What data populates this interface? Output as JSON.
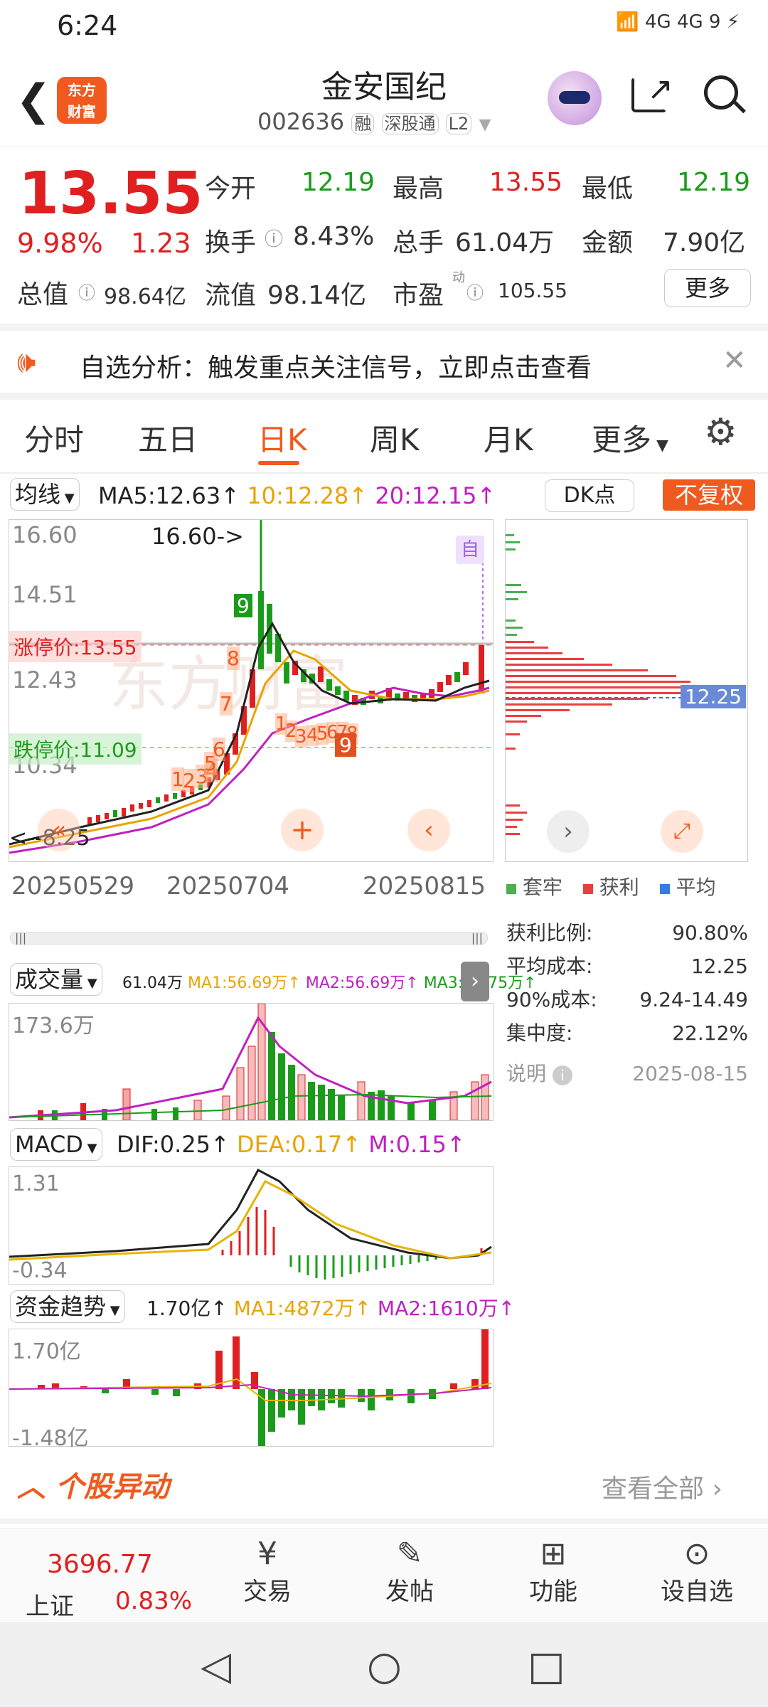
{
  "status_bar": {
    "time": "6:24",
    "indicators": "4G 4G 9"
  },
  "header": {
    "logo_text_1": "东方",
    "logo_text_2": "财富",
    "stock_name": "金安国纪",
    "stock_code": "002636",
    "tags": [
      "融",
      "深股通",
      "L2"
    ]
  },
  "quote": {
    "price": "13.55",
    "change_pct": "9.98%",
    "change": "1.23",
    "open_label": "今开",
    "open": "12.19",
    "high_label": "最高",
    "high": "13.55",
    "low_label": "最低",
    "low": "12.19",
    "turnover_label": "换手",
    "turnover": "8.43%",
    "volume_label": "总手",
    "volume": "61.04万",
    "amount_label": "金额",
    "amount": "7.90亿",
    "mktcap_label": "总值",
    "mktcap": "98.64亿",
    "float_label": "流值",
    "float_cap": "98.14亿",
    "pe_label": "市盈",
    "pe_sup": "动",
    "pe": "105.55",
    "more_button": "更多"
  },
  "alert": {
    "text": "自选分析：触发重点关注信号，立即点击查看"
  },
  "tabs": [
    "分时",
    "五日",
    "日K",
    "周K",
    "月K",
    "更多"
  ],
  "kchart": {
    "ma_selector": "均线",
    "ma5": "MA5:12.63↑",
    "ma10": "10:12.28↑",
    "ma20": "20:12.15↑",
    "dk_button": "DK点",
    "fq_button": "不复权",
    "y_top": "16.60",
    "y2": "14.51",
    "y3": "12.43",
    "y4": "10.34",
    "limit_up": "涨停价:13.55",
    "limit_down": "跌停价:11.09",
    "high_marker": "16.60->",
    "low_marker": "<--8.25",
    "auto_tag": "自",
    "dates": [
      "20250529",
      "20250704",
      "20250815"
    ],
    "watermark": "东方财富",
    "signals_up": [
      "1",
      "2",
      "3",
      "4",
      "5",
      "6",
      "7",
      "8",
      "9"
    ],
    "signals_down": [
      "1",
      "2",
      "3",
      "4",
      "5",
      "6",
      "7",
      "8",
      "9"
    ]
  },
  "chip": {
    "avg_tag": "12.25",
    "legend": [
      "套牢",
      "获利",
      "平均"
    ],
    "rows": [
      {
        "label": "获利比例:",
        "value": "90.80%"
      },
      {
        "label": "平均成本:",
        "value": "12.25"
      },
      {
        "label": "90%成本:",
        "value": "9.24-14.49"
      },
      {
        "label": "集中度:",
        "value": "22.12%"
      }
    ],
    "note_label": "说明",
    "date": "2025-08-15"
  },
  "volume": {
    "selector": "成交量",
    "val": "61.04万",
    "ma1": "MA1:56.69万↑",
    "ma2": "MA2:56.69万↑",
    "ma3": "MA3:32.75万↑",
    "ytop": "173.6万"
  },
  "macd": {
    "selector": "MACD",
    "dif": "DIF:0.25↑",
    "dea": "DEA:0.17↑",
    "m": "M:0.15↑",
    "ytop": "1.31",
    "ybot": "-0.34"
  },
  "fund": {
    "selector": "资金趋势",
    "val": "1.70亿↑",
    "ma1": "MA1:4872万↑",
    "ma2": "MA2:1610万↑",
    "ytop": "1.70亿",
    "ybot": "-1.48亿"
  },
  "movement": {
    "title": "个股异动",
    "view_all": "查看全部"
  },
  "bottom_nav": {
    "index_value": "3696.77",
    "index_name": "上证",
    "index_pct": "0.83%",
    "items": [
      "交易",
      "发帖",
      "功能",
      "设自选"
    ]
  },
  "colors": {
    "accent": "#f05a1e",
    "up": "#e02020",
    "down": "#1a9c1a"
  }
}
